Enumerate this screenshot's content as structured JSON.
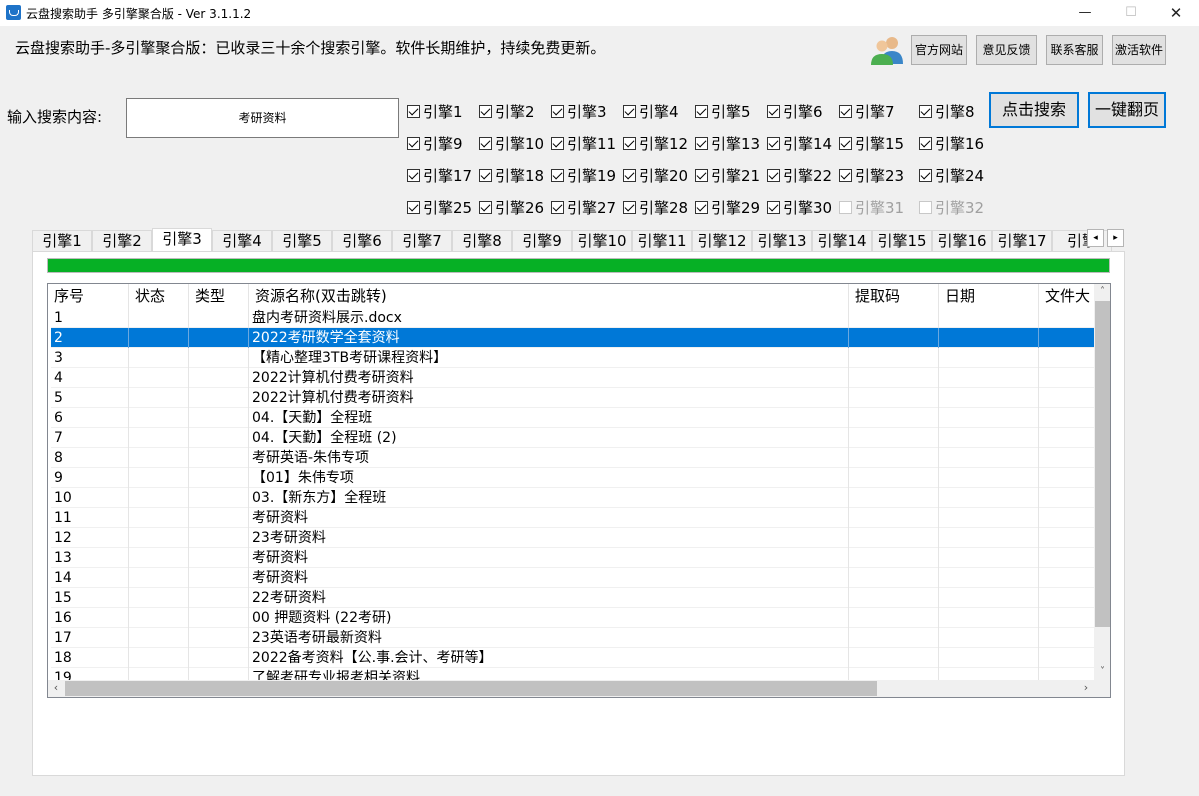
{
  "window": {
    "title": "云盘搜索助手 多引擎聚合版  -  Ver 3.1.1.2",
    "min_icon": "minimize-icon",
    "max_icon": "maximize-icon",
    "close_icon": "close-icon"
  },
  "header": {
    "description": "云盘搜索助手-多引擎聚合版：已收录三十余个搜索引擎。软件长期维护，持续免费更新。",
    "avatar_icon": "users-icon",
    "buttons": [
      "官方网站",
      "意见反馈",
      "联系客服",
      "激活软件"
    ]
  },
  "search": {
    "label": "输入搜索内容:",
    "value": "考研资料",
    "search_button": "点击搜索",
    "page_button": "一键翻页"
  },
  "engines": [
    {
      "label": "引擎1",
      "checked": true
    },
    {
      "label": "引擎2",
      "checked": true
    },
    {
      "label": "引擎3",
      "checked": true
    },
    {
      "label": "引擎4",
      "checked": true
    },
    {
      "label": "引擎5",
      "checked": true
    },
    {
      "label": "引擎6",
      "checked": true
    },
    {
      "label": "引擎7",
      "checked": true
    },
    {
      "label": "引擎8",
      "checked": true
    },
    {
      "label": "引擎9",
      "checked": true
    },
    {
      "label": "引擎10",
      "checked": true
    },
    {
      "label": "引擎11",
      "checked": true
    },
    {
      "label": "引擎12",
      "checked": true
    },
    {
      "label": "引擎13",
      "checked": true
    },
    {
      "label": "引擎14",
      "checked": true
    },
    {
      "label": "引擎15",
      "checked": true
    },
    {
      "label": "引擎16",
      "checked": true
    },
    {
      "label": "引擎17",
      "checked": true
    },
    {
      "label": "引擎18",
      "checked": true
    },
    {
      "label": "引擎19",
      "checked": true
    },
    {
      "label": "引擎20",
      "checked": true
    },
    {
      "label": "引擎21",
      "checked": true
    },
    {
      "label": "引擎22",
      "checked": true
    },
    {
      "label": "引擎23",
      "checked": true
    },
    {
      "label": "引擎24",
      "checked": true
    },
    {
      "label": "引擎25",
      "checked": true
    },
    {
      "label": "引擎26",
      "checked": true
    },
    {
      "label": "引擎27",
      "checked": true
    },
    {
      "label": "引擎28",
      "checked": true
    },
    {
      "label": "引擎29",
      "checked": true
    },
    {
      "label": "引擎30",
      "checked": true
    },
    {
      "label": "引擎31",
      "checked": false,
      "disabled": true
    },
    {
      "label": "引擎32",
      "checked": false,
      "disabled": true
    }
  ],
  "tabs": {
    "items": [
      "引擎1",
      "引擎2",
      "引擎3",
      "引擎4",
      "引擎5",
      "引擎6",
      "引擎7",
      "引擎8",
      "引擎9",
      "引擎10",
      "引擎11",
      "引擎12",
      "引擎13",
      "引擎14",
      "引擎15",
      "引擎16",
      "引擎17",
      "引擎"
    ],
    "active_index": 2,
    "scroll_left": "◂",
    "scroll_right": "▸"
  },
  "progress": {
    "fraction": 1.0,
    "color": "#06b025"
  },
  "table": {
    "columns": [
      "序号",
      "状态",
      "类型",
      "资源名称(双击跳转)",
      "提取码",
      "日期",
      "文件大"
    ],
    "selected_index": 1,
    "selection_color": "#0078d7",
    "rows": [
      [
        "1",
        "",
        "",
        "盘内考研资料展示.docx",
        "",
        "",
        ""
      ],
      [
        "2",
        "",
        "",
        "2022考研数学全套资料",
        "",
        "",
        ""
      ],
      [
        "3",
        "",
        "",
        "【精心整理3TB考研课程资料】",
        "",
        "",
        ""
      ],
      [
        "4",
        "",
        "",
        "2022计算机付费考研资料",
        "",
        "",
        ""
      ],
      [
        "5",
        "",
        "",
        "2022计算机付费考研资料",
        "",
        "",
        ""
      ],
      [
        "6",
        "",
        "",
        "04.【天勤】全程班",
        "",
        "",
        ""
      ],
      [
        "7",
        "",
        "",
        "04.【天勤】全程班 (2)",
        "",
        "",
        ""
      ],
      [
        "8",
        "",
        "",
        "考研英语-朱伟专项",
        "",
        "",
        ""
      ],
      [
        "9",
        "",
        "",
        "【01】朱伟专项",
        "",
        "",
        ""
      ],
      [
        "10",
        "",
        "",
        "03.【新东方】全程班",
        "",
        "",
        ""
      ],
      [
        "11",
        "",
        "",
        "考研资料",
        "",
        "",
        ""
      ],
      [
        "12",
        "",
        "",
        "23考研资料",
        "",
        "",
        ""
      ],
      [
        "13",
        "",
        "",
        "考研资料",
        "",
        "",
        ""
      ],
      [
        "14",
        "",
        "",
        "考研资料",
        "",
        "",
        ""
      ],
      [
        "15",
        "",
        "",
        "22考研资料",
        "",
        "",
        ""
      ],
      [
        "16",
        "",
        "",
        "00 押题资料 (22考研)",
        "",
        "",
        ""
      ],
      [
        "17",
        "",
        "",
        "23英语考研最新资料",
        "",
        "",
        ""
      ],
      [
        "18",
        "",
        "",
        "2022备考资料【公.事.会计、考研等】",
        "",
        "",
        ""
      ],
      [
        "19",
        "",
        "",
        "了解考研专业报考相关资料",
        "",
        "",
        ""
      ]
    ],
    "vscroll_up": "˄",
    "vscroll_down": "˅",
    "hscroll_left": "‹",
    "hscroll_right": "›"
  }
}
